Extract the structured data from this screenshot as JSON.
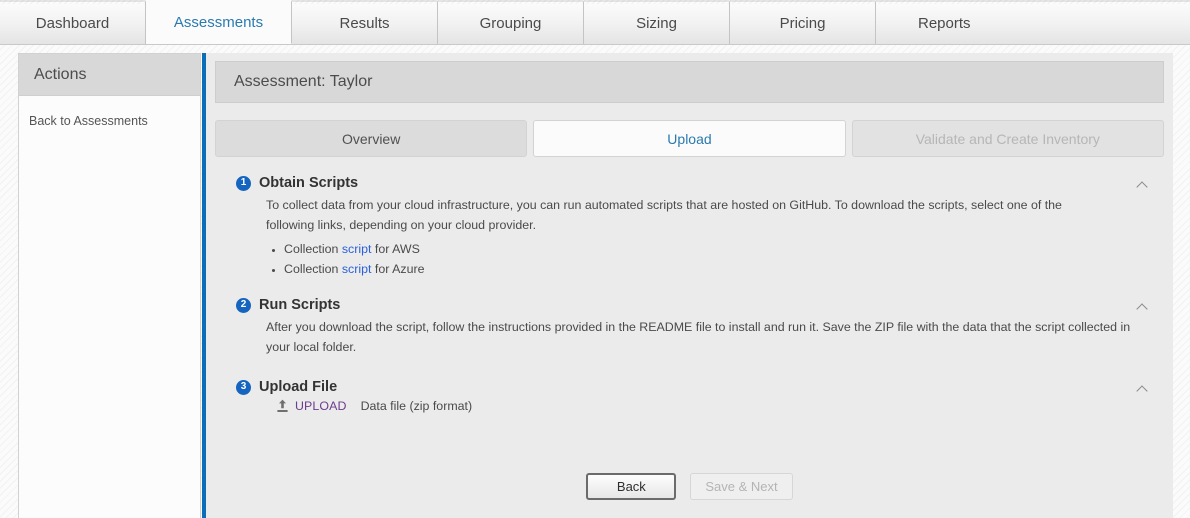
{
  "topnav": {
    "tabs": [
      {
        "label": "Dashboard",
        "state": "normal"
      },
      {
        "label": "Assessments",
        "state": "active"
      },
      {
        "label": "Results",
        "state": "normal"
      },
      {
        "label": "Grouping",
        "state": "normal"
      },
      {
        "label": "Sizing",
        "state": "normal"
      },
      {
        "label": "Pricing",
        "state": "normal"
      },
      {
        "label": "Reports",
        "state": "normal"
      }
    ]
  },
  "sidebar": {
    "header": "Actions",
    "links": [
      {
        "label": "Back to Assessments"
      }
    ]
  },
  "main": {
    "page_title": "Assessment: Taylor",
    "step_tabs": [
      {
        "label": "Overview",
        "state": "done"
      },
      {
        "label": "Upload",
        "state": "current"
      },
      {
        "label": "Validate and Create Inventory",
        "state": "disabled"
      }
    ],
    "steps": [
      {
        "number": "1",
        "title": "Obtain Scripts",
        "paragraph": "To collect data from your cloud infrastructure, you can run automated scripts that are hosted on GitHub. To download the scripts, select one of the following links, depending on your cloud provider.",
        "bullets": [
          {
            "prefix": "Collection ",
            "link": "script",
            "suffix": " for AWS"
          },
          {
            "prefix": "Collection ",
            "link": "script",
            "suffix": " for Azure"
          }
        ],
        "collapse_icon": "chevron-up-icon"
      },
      {
        "number": "2",
        "title": "Run Scripts",
        "paragraph": "After you download the script, follow the instructions provided in the README file to install and run it. Save the ZIP file with the data that the script collected in your local folder.",
        "collapse_icon": "chevron-up-icon"
      },
      {
        "number": "3",
        "title": "Upload File",
        "upload_icon": "upload-icon",
        "upload_label": "UPLOAD",
        "upload_note": "Data file (zip format)",
        "collapse_icon": "chevron-up-icon"
      }
    ],
    "footer": {
      "back_label": "Back",
      "next_label": "Save & Next"
    }
  },
  "colors": {
    "accent_blue": "#0a6fb8",
    "link_blue": "#2b61d8",
    "tab_blue": "#2a7ab0",
    "badge_blue": "#1565c0",
    "upload_purple": "#6e3b8e"
  }
}
